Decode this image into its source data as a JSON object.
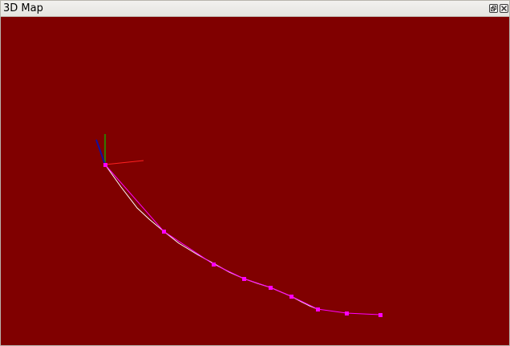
{
  "window": {
    "title": "3D Map",
    "buttons": [
      {
        "name": "float",
        "icon": "float-icon"
      },
      {
        "name": "close",
        "icon": "close-icon"
      }
    ]
  },
  "scene": {
    "background_color": "#800000",
    "trajectory_color": "#ff00ff",
    "path_color": "#ffffff",
    "axis_colors": {
      "x": "#ff0000",
      "y": "#00c800",
      "z": "#0000b4"
    }
  }
}
